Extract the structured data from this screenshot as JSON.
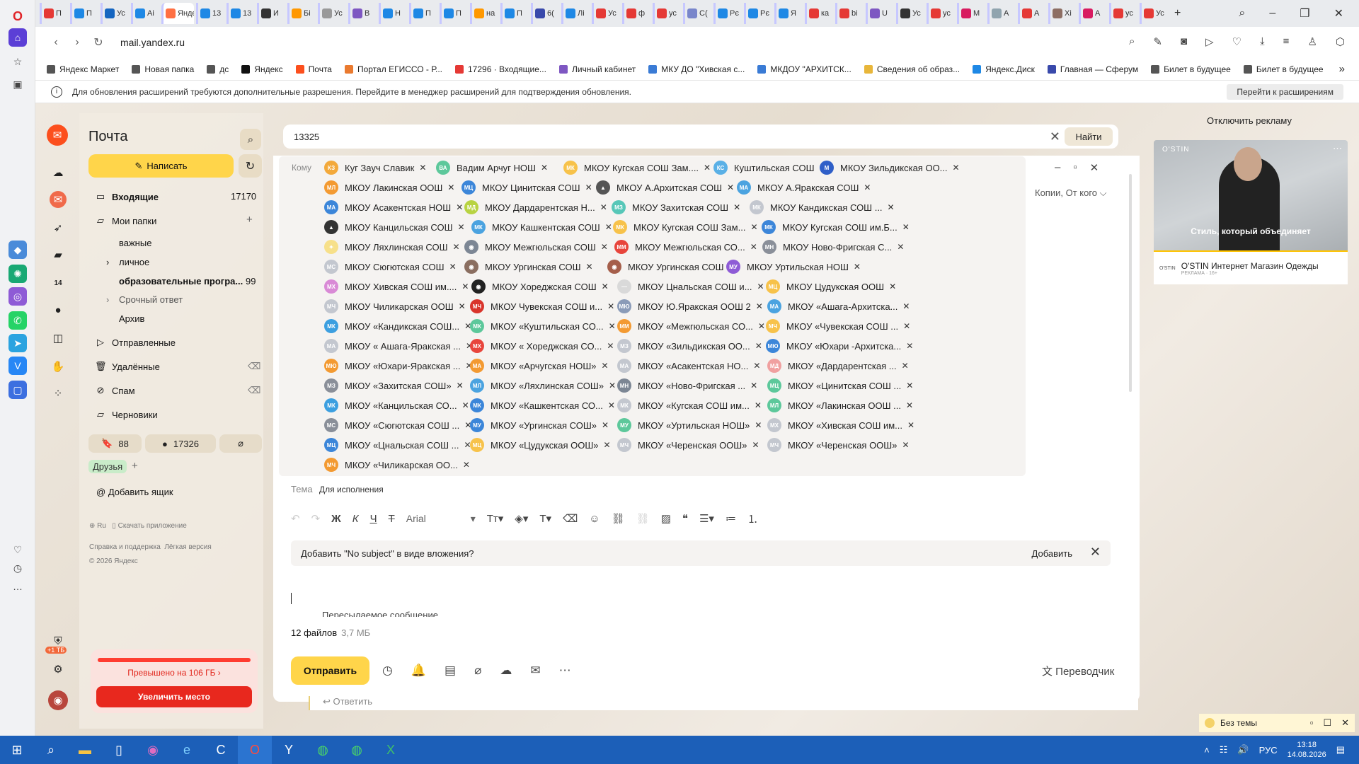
{
  "browser": {
    "tabs": [
      "П",
      "П",
      "Ус",
      "Аі",
      "Янде",
      "13",
      "13",
      "И",
      "Бі",
      "Ус",
      "В",
      "Н",
      "П",
      "П",
      "на",
      "П",
      "6(",
      "Лі",
      "Ус",
      "ф",
      "ус",
      "С(",
      "Рє",
      "Рє",
      "Я",
      "ка",
      "bi",
      "U",
      "Ус",
      "ус",
      "М",
      "А",
      "А",
      "Хі",
      "А",
      "ус",
      "Ус"
    ],
    "url": "mail.yandex.ru",
    "bookmarks": [
      "Яндекс Маркет",
      "Новая папка",
      "дс",
      "Яндекс",
      "Почта",
      "Портал ЕГИССО - Р...",
      "17296 · Входящие...",
      "Личный кабинет",
      "МКУ ДО \"Хивская с...",
      "МКДОУ \"АРХИТСК...",
      "Сведения об образ...",
      "Яндекс.Диск",
      "Главная — Сферум",
      "Билет в будущее",
      "Билет в будущее"
    ],
    "info_text": "Для обновления расширений требуются дополнительные разрешения. Перейдите в менеджер расширений для подтверждения обновления.",
    "info_button": "Перейти к расширениям"
  },
  "sidebar": {
    "title": "Почта",
    "compose": "Написать",
    "inbox": "Входящие",
    "inbox_count": "17170",
    "my_folders": "Мои папки",
    "sub": [
      "важные",
      "личное",
      "образовательные програ...",
      "Срочный ответ",
      "Архив"
    ],
    "edu_count": "99",
    "sent": "Отправленные",
    "deleted": "Удалённые",
    "spam": "Спам",
    "drafts": "Черновики",
    "stat_bookmark": "88",
    "stat_unread": "17326",
    "friends": "Друзья",
    "add_box": "Добавить ящик",
    "lang": "Ru",
    "download": "Скачать приложение",
    "help": "Справка и поддержка",
    "light": "Лёгкая версия",
    "copy": "© 2026 Яндекс",
    "storage_badge": "+1 ТБ",
    "quota_text": "Превышено на 106 ГБ  ›",
    "quota_button": "Увеличить место"
  },
  "search": {
    "value": "13325",
    "button": "Найти"
  },
  "compose": {
    "to_label": "Кому",
    "cc_label": "Копии, От кого ⌵",
    "subject_label": "Тема",
    "subject": "Для исполнения",
    "font": "Arial",
    "attach_prompt": "Добавить \"No subject\" в виде вложения?",
    "attach_add": "Добавить",
    "forwarded": "Пересылаемое сообщение",
    "files": "12 файлов",
    "files_size": "3,7 МБ",
    "send": "Отправить",
    "translator": "Переводчик",
    "reply": "Ответить",
    "recipients": [
      {
        "name": "Куг Зауч Славик",
        "ini": "КЗ",
        "color": "#f3a93b"
      },
      {
        "name": "Вадим Арчуг НОШ",
        "ini": "ВА",
        "color": "#5dc89b"
      },
      {
        "name": "МКОУ Кугская СОШ Зам....",
        "ini": "МК",
        "color": "#f7c24a"
      },
      {
        "name": "Куштильская СОШ",
        "ini": "КС",
        "color": "#5ab0e6"
      },
      {
        "name": "МКОУ Зильдикская ОО...",
        "ini": "М",
        "color": "#2f5fc8"
      },
      {
        "name": "МКОУ Лакинская ООШ",
        "ini": "МЛ",
        "color": "#f39a32"
      },
      {
        "name": "МКОУ Цинитская СОШ",
        "ini": "МЦ",
        "color": "#3c86d9"
      },
      {
        "name": "МКОУ А.Архитская СОШ",
        "ini": "▲",
        "color": "#555555"
      },
      {
        "name": "МКОУ А.Яракская СОШ",
        "ini": "МА",
        "color": "#4ba3e0"
      },
      {
        "name": "МКОУ Асакентская НОШ",
        "ini": "МА",
        "color": "#3c86d9"
      },
      {
        "name": "МКОУ Дардарентская Н...",
        "ini": "МД",
        "color": "#b8d342"
      },
      {
        "name": "МКОУ Захитская СОШ",
        "ini": "МЗ",
        "color": "#57c7b8"
      },
      {
        "name": "МКОУ Кандикская СОШ ...",
        "ini": "МК",
        "color": "#c3c7cf"
      },
      {
        "name": "МКОУ Канцильская СОШ",
        "ini": "▲",
        "color": "#333333"
      },
      {
        "name": "МКОУ Кашкентская СОШ",
        "ini": "МК",
        "color": "#4ba3e0"
      },
      {
        "name": "МКОУ Кугская СОШ Зам...",
        "ini": "МК",
        "color": "#f7c24a"
      },
      {
        "name": "МКОУ Кугская СОШ им.Б...",
        "ini": "МК",
        "color": "#3c86d9"
      },
      {
        "name": "МКОУ Ляхлинская СОШ",
        "ini": "✦",
        "color": "#f7e08a"
      },
      {
        "name": "МКОУ Межгюльская СОШ",
        "ini": "◉",
        "color": "#7c8694"
      },
      {
        "name": "МКОУ Межгюльская СО...",
        "ini": "ММ",
        "color": "#e8453c"
      },
      {
        "name": "МКОУ Ново-Фригская С...",
        "ini": "МН",
        "color": "#8a8f99"
      },
      {
        "name": "МКОУ Сюгютская СОШ",
        "ini": "МС",
        "color": "#c3c7cf"
      },
      {
        "name": "МКОУ Ургинская СОШ",
        "ini": "◉",
        "color": "#8a6e60"
      },
      {
        "name": "МКОУ Ургинская СОШ",
        "ini": "◉",
        "color": "#a55e4a"
      },
      {
        "name": "МКОУ Уртильская НОШ",
        "ini": "МУ",
        "color": "#8e5bd6"
      },
      {
        "name": "МКОУ Хивская СОШ им....",
        "ini": "МХ",
        "color": "#d98ad6"
      },
      {
        "name": "МКОУ Хореджская СОШ",
        "ini": "◉",
        "color": "#222222"
      },
      {
        "name": "МКОУ Цнальская СОШ и...",
        "ini": "—",
        "color": "#d9d9d9"
      },
      {
        "name": "МКОУ Цудукская ООШ",
        "ini": "МЦ",
        "color": "#f7c24a"
      },
      {
        "name": "МКОУ Чиликарская ООШ",
        "ini": "МЧ",
        "color": "#c3c7cf"
      },
      {
        "name": "МКОУ Чувекская СОШ и...",
        "ini": "МЧ",
        "color": "#d9342b"
      },
      {
        "name": "МКОУ Ю.Яракская ООШ 2",
        "ini": "МЮ",
        "color": "#8a9bb8"
      },
      {
        "name": "МКОУ «Ашага-Архитска...",
        "ini": "МА",
        "color": "#4ba3e0"
      },
      {
        "name": "МКОУ «Кандикская СОШ...",
        "ini": "МК",
        "color": "#3c9fe0"
      },
      {
        "name": "МКОУ «Куштильская СО...",
        "ini": "МК",
        "color": "#5dc89b"
      },
      {
        "name": "МКОУ «Межгюльская СО...",
        "ini": "ММ",
        "color": "#f39a32"
      },
      {
        "name": "МКОУ «Чувекская СОШ ...",
        "ini": "МЧ",
        "color": "#f7c24a"
      },
      {
        "name": "МКОУ « Ашага-Яракская ...",
        "ini": "МА",
        "color": "#c3c7cf"
      },
      {
        "name": "МКОУ « Хореджская СО...",
        "ini": "МХ",
        "color": "#e8453c"
      },
      {
        "name": "МКОУ «Зильдикская ОО...",
        "ini": "МЗ",
        "color": "#c3c7cf"
      },
      {
        "name": "МКОУ «Юхари -Архитска...",
        "ini": "МЮ",
        "color": "#3c86d9"
      },
      {
        "name": "МКОУ «Юхари-Яракская ...",
        "ini": "МЮ",
        "color": "#f39a32"
      },
      {
        "name": "МКОУ «Арчугская НОШ»",
        "ini": "МА",
        "color": "#f39a32"
      },
      {
        "name": "МКОУ «Асакентская НО...",
        "ini": "МА",
        "color": "#c3c7cf"
      },
      {
        "name": "МКОУ «Дардарентская ...",
        "ini": "МД",
        "color": "#f0a0a0"
      },
      {
        "name": "МКОУ «Захитская СОШ»",
        "ini": "МЗ",
        "color": "#8a8f99"
      },
      {
        "name": "МКОУ «Ляхлинская СОШ»",
        "ini": "МЛ",
        "color": "#4ba3e0"
      },
      {
        "name": "МКОУ «Ново-Фригская ...",
        "ini": "МН",
        "color": "#7c8694"
      },
      {
        "name": "МКОУ «Цинитская СОШ ...",
        "ini": "МЦ",
        "color": "#5dc89b"
      },
      {
        "name": "МКОУ «Канцильская СО...",
        "ini": "МК",
        "color": "#3c9fe0"
      },
      {
        "name": "МКОУ «Кашкентская СО...",
        "ini": "МК",
        "color": "#3c86d9"
      },
      {
        "name": "МКОУ «Кугская СОШ им...",
        "ini": "МК",
        "color": "#c3c7cf"
      },
      {
        "name": "МКОУ «Лакинская ООШ ...",
        "ini": "МЛ",
        "color": "#5dc89b"
      },
      {
        "name": "МКОУ «Сюгютская СОШ ...",
        "ini": "МС",
        "color": "#8a8f99"
      },
      {
        "name": "МКОУ «Ургинская СОШ»",
        "ini": "МУ",
        "color": "#3c86d9"
      },
      {
        "name": "МКОУ «Уртильская НОШ»",
        "ini": "МУ",
        "color": "#5dc89b"
      },
      {
        "name": "МКОУ «Хивская СОШ им...",
        "ini": "МХ",
        "color": "#c3c7cf"
      },
      {
        "name": "МКОУ «Цнальская СОШ ...",
        "ini": "МЦ",
        "color": "#3c86d9"
      },
      {
        "name": "МКОУ «Цудукская ООШ»",
        "ini": "МЦ",
        "color": "#f7c24a"
      },
      {
        "name": "МКОУ «Черенская ООШ»",
        "ini": "МЧ",
        "color": "#c3c7cf"
      },
      {
        "name": "МКОУ «Черенская ООШ»",
        "ini": "МЧ",
        "color": "#c3c7cf"
      },
      {
        "name": "МКОУ «Чиликарская ОО...",
        "ini": "МЧ",
        "color": "#f39a32"
      }
    ]
  },
  "ads": {
    "disable": "Отключить рекламу",
    "brand": "O'STIN",
    "slogan": "Стиль, который объединяет",
    "title": "O'STIN Интернет Магазин Одежды",
    "small": "РЕКЛАМА · 16+"
  },
  "notification": {
    "text": "Без темы"
  },
  "taskbar": {
    "lang": "РУС",
    "time": "13:18",
    "date": "14.08.2026"
  }
}
